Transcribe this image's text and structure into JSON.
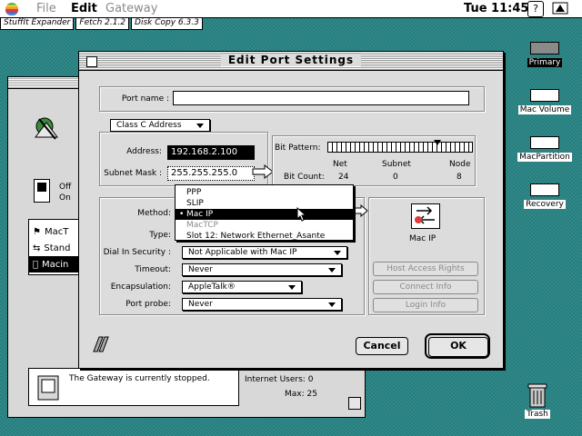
{
  "menubar": {
    "file": "File",
    "edit": "Edit",
    "gateway": "Gateway",
    "clock": "Tue 11:45"
  },
  "apps": [
    "StuffIt Expander",
    "Fetch 2.1.2",
    "Disk Copy 6.3.3"
  ],
  "desktop_icons": [
    {
      "label": "Primary"
    },
    {
      "label": "Mac Volume"
    },
    {
      "label": "MacPartition"
    },
    {
      "label": "Recovery"
    },
    {
      "label": "Trash"
    }
  ],
  "bg_window": {
    "switch_off": "Off",
    "switch_on": "On",
    "rows": [
      "MacT",
      "Stand",
      "Macin"
    ],
    "status": "The Gateway is currently stopped.",
    "internet_users": "Internet Users: 0",
    "max": "Max: 25"
  },
  "dialog": {
    "title": "Edit Port Settings",
    "port_name_label": "Port name :",
    "port_name_value": "",
    "address_class": "Class C Address",
    "address_label": "Address:",
    "address_value": "192.168.2.100",
    "subnet_label": "Subnet Mask :",
    "subnet_value": "255.255.255.0",
    "bit_pattern_label": "Bit Pattern:",
    "bit_headers": [
      "Net",
      "Subnet",
      "Node"
    ],
    "bit_count_label": "Bit Count:",
    "bit_counts": [
      "24",
      "0",
      "8"
    ],
    "method_label": "Method:",
    "type_label": "Type:",
    "dialin_label": "Dial In Security :",
    "dialin_value": "Not Applicable with Mac IP",
    "timeout_label": "Timeout:",
    "timeout_value": "Never",
    "encap_label": "Encapsulation:",
    "encap_value": "AppleTalk®",
    "probe_label": "Port probe:",
    "probe_value": "Never",
    "macip_label": "Mac IP",
    "host_access": "Host Access Rights",
    "connect_info": "Connect Info",
    "login_info": "Login Info",
    "cancel": "Cancel",
    "ok": "OK"
  },
  "method_menu": {
    "options": [
      {
        "label": "PPP",
        "state": "normal"
      },
      {
        "label": "SLIP",
        "state": "normal"
      },
      {
        "label": "Mac IP",
        "state": "selected",
        "mark": "•"
      },
      {
        "label": "MacTCP",
        "state": "disabled"
      },
      {
        "label": "Slot 12: Network Ethernet_Asante",
        "state": "normal"
      }
    ]
  }
}
